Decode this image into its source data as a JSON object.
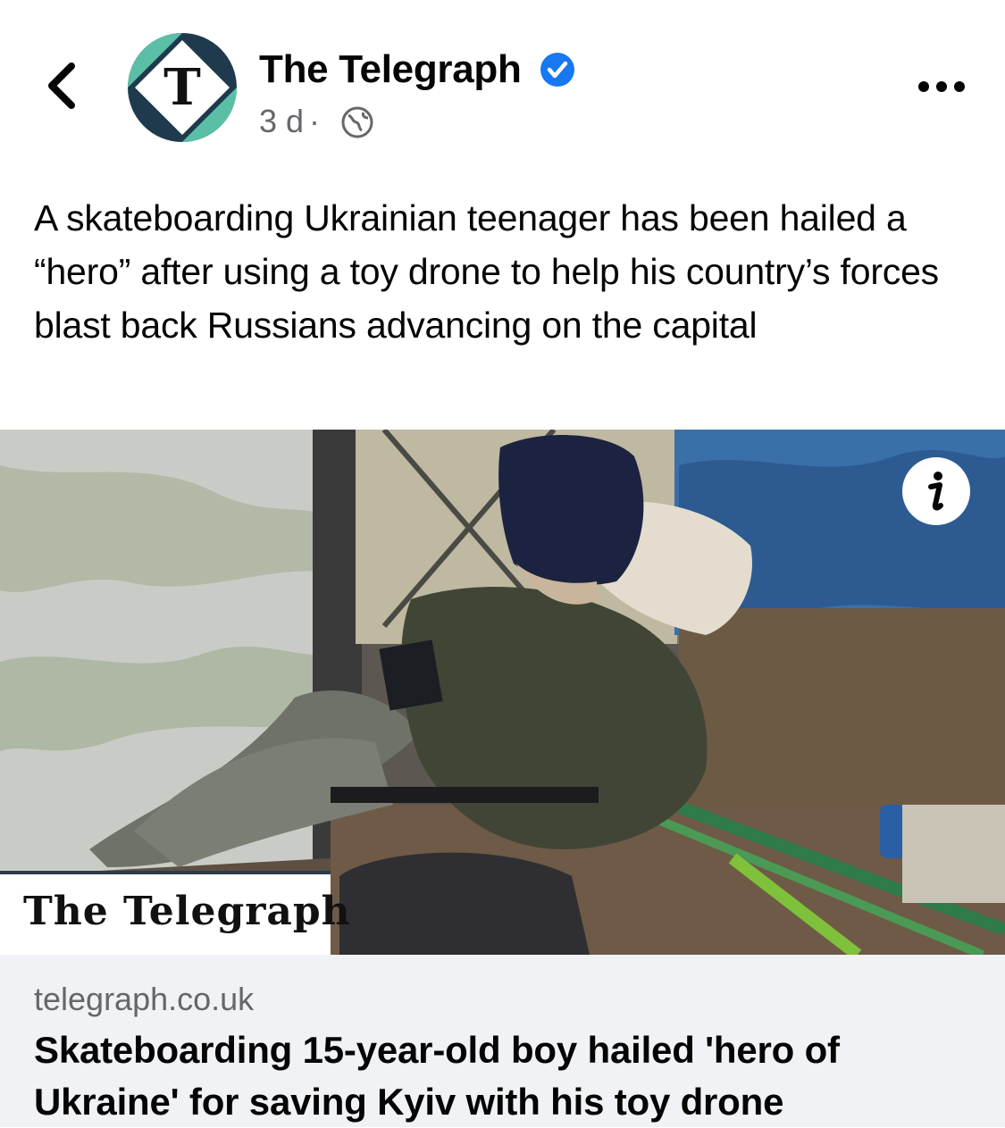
{
  "post": {
    "page_name": "The Telegraph",
    "time": "3 d",
    "separator": "·",
    "caption": "A skateboarding Ukrainian teenager has been hailed a “hero” after using a toy drone to help his country’s forces blast back Russians advancing on the capital"
  },
  "icons": {
    "back": "chevron-left-icon",
    "verified": "verified-badge-icon",
    "audience": "globe-icon",
    "more": "more-horizontal-icon",
    "info": "info-icon"
  },
  "image": {
    "watermark": "The Telegraph"
  },
  "link": {
    "domain": "telegraph.co.uk",
    "headline": "Skateboarding 15-year-old boy hailed 'hero of Ukraine' for saving Kyiv with his toy drone"
  },
  "colors": {
    "verified_blue": "#1877f2",
    "logo_navy": "#1f3a4d",
    "logo_teal": "#5bbfa8",
    "card_background": "#f0f2f5",
    "secondary_text": "#65676b"
  }
}
